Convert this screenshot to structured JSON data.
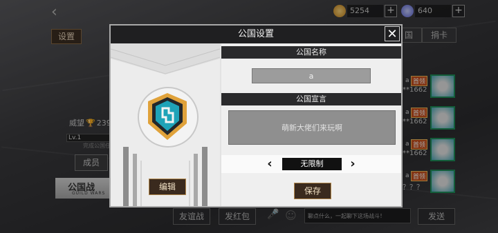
{
  "topbar": {
    "gold": "5254",
    "gems": "640",
    "plus": "+",
    "back_glyph": "‹",
    "colors": {
      "gold": "#e0a52a",
      "gem": "#6a7ef0"
    }
  },
  "underlay": {
    "settings_label": "设置",
    "prestige_label": "威望",
    "prestige_value": "239",
    "level": "Lv.1",
    "sub_note": "完成公国任",
    "members_label": "成员",
    "guildwar_title": "公国战",
    "guildwar_sub": "GUILD WARS",
    "tabs": [
      "国",
      "捐卡"
    ],
    "right_rows": [
      {
        "prefix": "a",
        "badge": "首领",
        "num": "**1662"
      },
      {
        "prefix": "a",
        "badge": "首领",
        "num": "**1662"
      },
      {
        "prefix": "a",
        "badge": "首领",
        "num": "**1662"
      },
      {
        "prefix": "a",
        "badge": "首领",
        "num": "？？？"
      }
    ],
    "friendly_battle": "友谊战",
    "red_packet": "发红包",
    "chat_placeholder": "聊点什么，一起聊下这场战斗！",
    "send": "发送"
  },
  "dialog": {
    "title": "公国设置",
    "close_glyph": "✕",
    "name_header": "公国名称",
    "name_value": "a",
    "declaration_header": "公国宣言",
    "declaration_value": "萌新大佬们来玩啊",
    "limit_value": "无限制",
    "prev_glyph": "‹",
    "next_glyph": "›",
    "edit_label": "编辑",
    "save_label": "保存",
    "accent": "#1fa3b8",
    "badge_gold": "#e0a23a"
  }
}
